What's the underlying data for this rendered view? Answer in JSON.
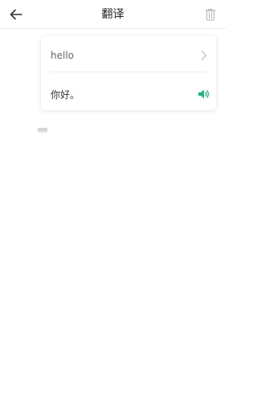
{
  "header": {
    "title": "翻译",
    "back_icon": "arrow-left-icon",
    "delete_icon": "trash-icon"
  },
  "card": {
    "source_text": "hello",
    "source_icon": "chevron-right-icon",
    "result_text": "你好。",
    "speak_icon": "speaker-icon",
    "accent_color": "#1fb37a"
  },
  "footnote": "刚刚"
}
